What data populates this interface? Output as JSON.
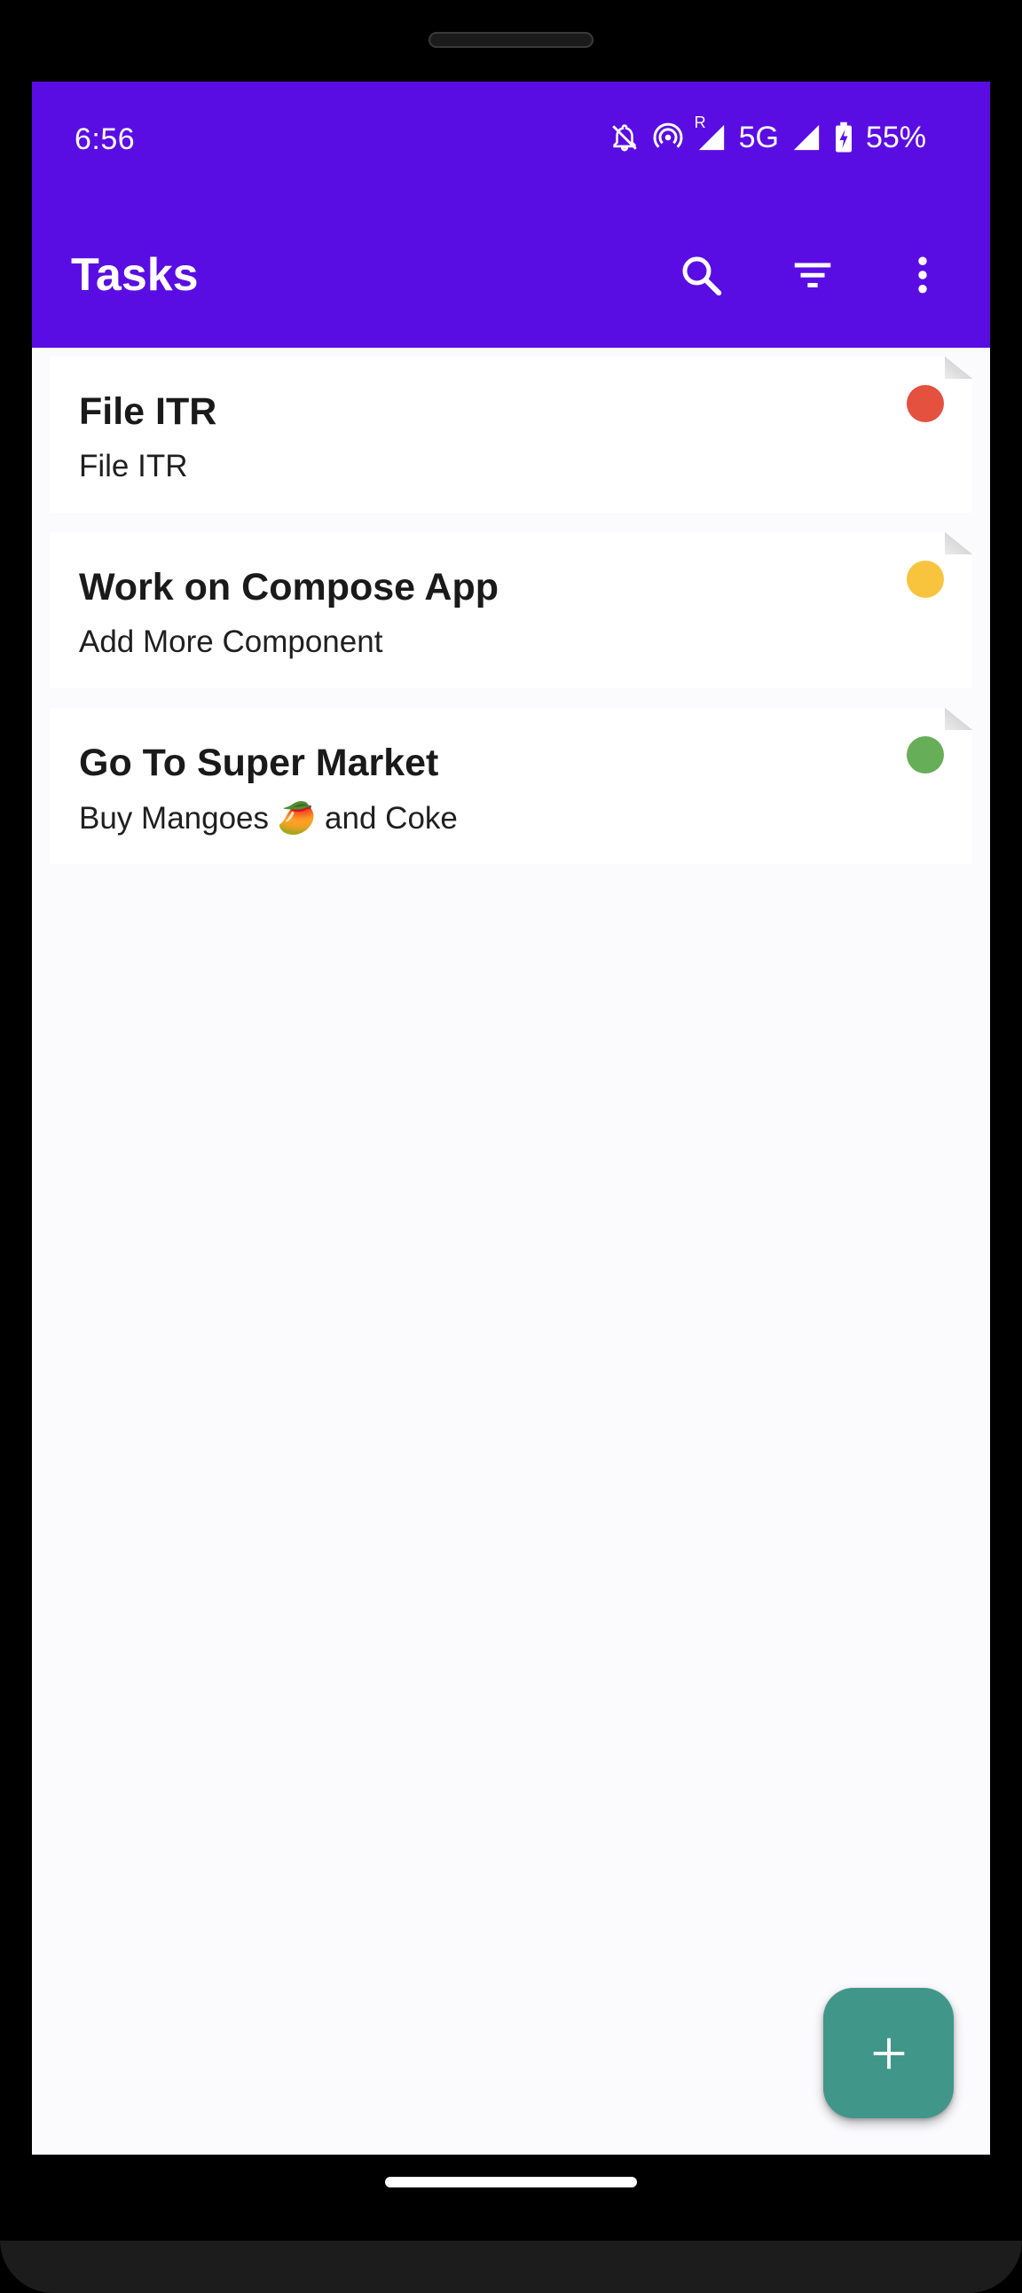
{
  "status_bar": {
    "time": "6:56",
    "roaming_indicator": "R",
    "network": "5G",
    "battery": "55%",
    "icons": [
      "bell-off-icon",
      "hotspot-icon",
      "signal-icon",
      "signal-icon",
      "battery-charging-icon"
    ]
  },
  "app_bar": {
    "title": "Tasks",
    "actions": [
      "search-icon",
      "filter-icon",
      "more-vert-icon"
    ]
  },
  "tasks": [
    {
      "title": "File ITR",
      "description": "File ITR",
      "priority_color": "#e4513e"
    },
    {
      "title": "Work on Compose App",
      "description": "Add More Component",
      "priority_color": "#f8c43d"
    },
    {
      "title": "Go To Super Market",
      "description": "Buy Mangoes 🥭 and Coke",
      "priority_color": "#66ae58"
    }
  ],
  "fab": {
    "icon": "add-icon"
  },
  "colors": {
    "app_bar": "#5a0de3",
    "fab": "#409789",
    "background": "#fbfbfe"
  }
}
